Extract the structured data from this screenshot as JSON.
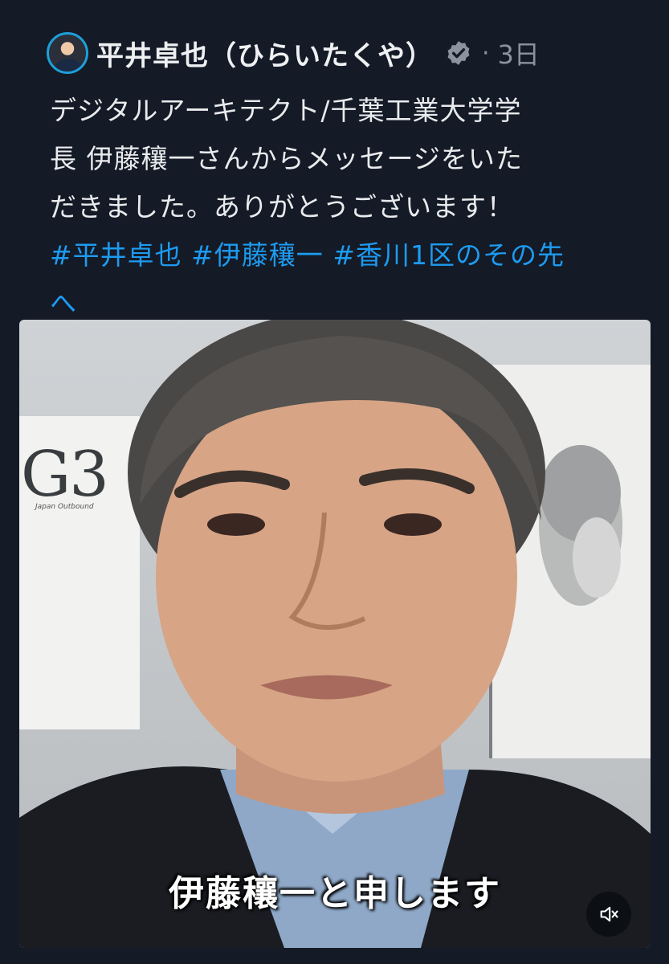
{
  "post": {
    "author": "平井卓也（ひらいたくや）",
    "separator": "·",
    "time": "3日",
    "text_lines": [
      "デジタルアーキテクト/千葉工業大学学",
      "長 伊藤穰一さんからメッセージをいた",
      "だきました。ありがとうございます！"
    ],
    "hashtags": [
      "#平井卓也",
      "#伊藤穰一",
      "#香川1区のその先",
      "へ"
    ]
  },
  "video": {
    "poster_text": "G3",
    "poster_subtext": "Japan Outbound",
    "caption": "伊藤穰一と申します",
    "mute_icon": "speaker-muted-icon"
  },
  "colors": {
    "background": "#141a26",
    "link": "#1d9bf0",
    "muted": "#8b949e"
  }
}
